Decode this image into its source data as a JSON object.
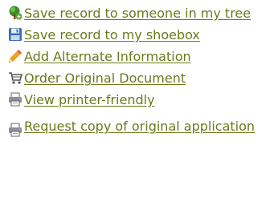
{
  "actions": [
    {
      "label": "Save record to someone in my tree",
      "icon": "tree-add-icon"
    },
    {
      "label": "Save record to my shoebox",
      "icon": "floppy-disk-icon"
    },
    {
      "label": "Add Alternate Information",
      "icon": "pencil-icon"
    },
    {
      "label": "Order Original Document",
      "icon": "shopping-cart-icon"
    },
    {
      "label": "View printer-friendly",
      "icon": "printer-icon"
    },
    {
      "label": "Request copy of original application",
      "icon": "printer-icon"
    }
  ],
  "colors": {
    "link": "#6b7a1b",
    "background": "#ffffff"
  }
}
